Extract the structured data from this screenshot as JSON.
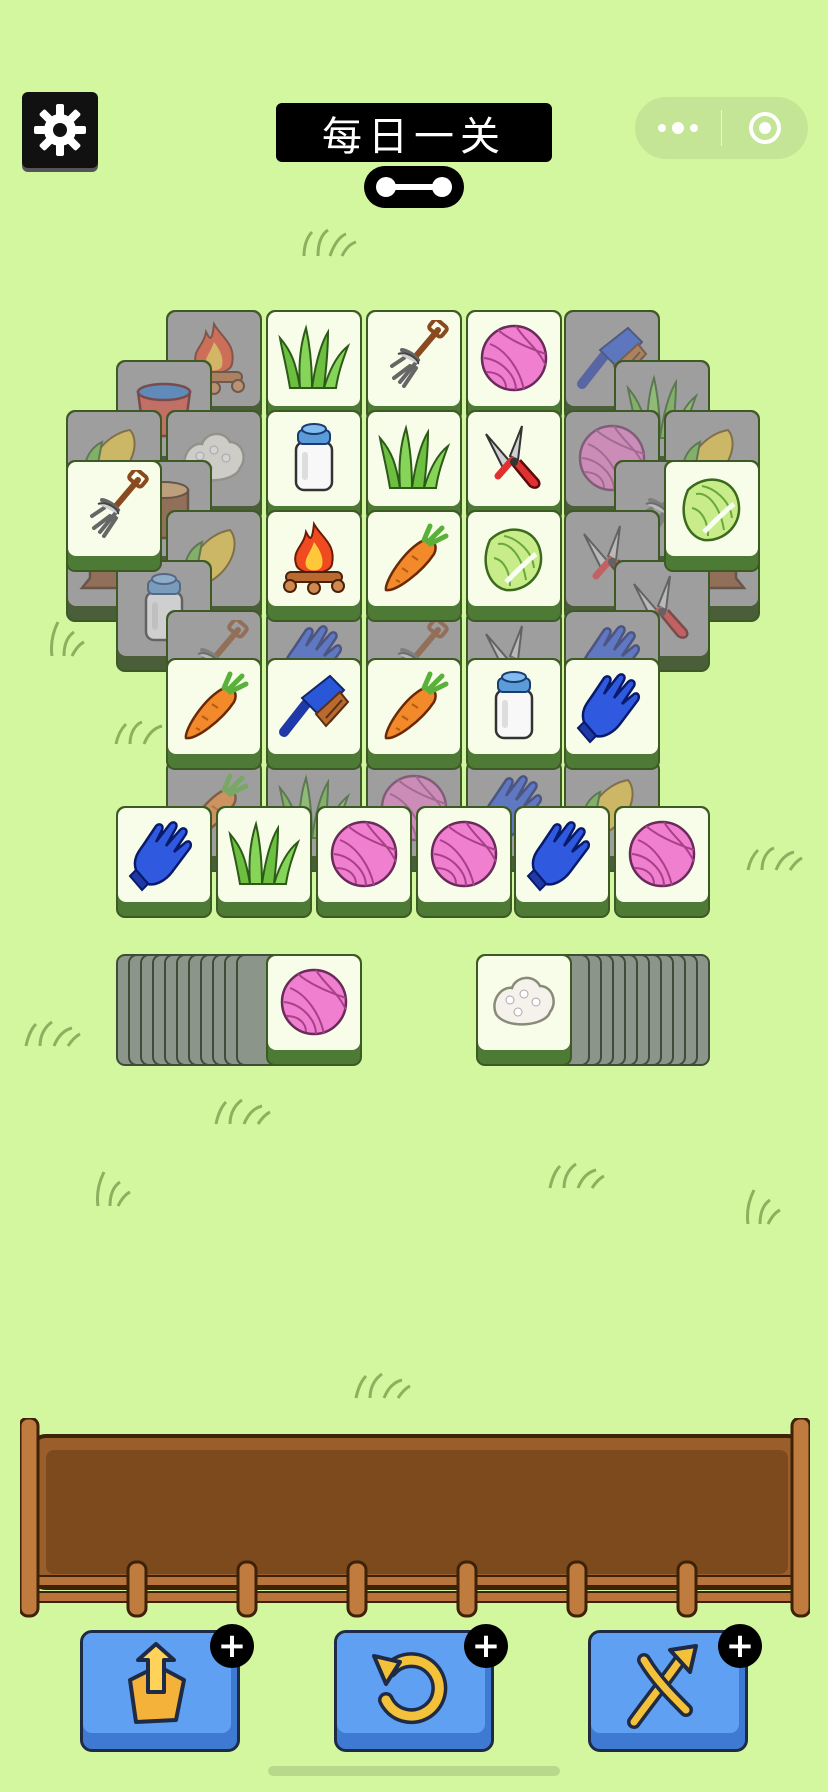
{
  "header": {
    "title": "每日一关",
    "settings_icon": "gear-icon",
    "menu_icon": "more-dots-icon",
    "close_icon": "target-circle-icon"
  },
  "progress": {
    "icon": "bone-progress-icon"
  },
  "board": {
    "top_layer_tiles": [
      "grass",
      "pitchfork",
      "yarn",
      "brush",
      "milk",
      "grass",
      "shears",
      "campfire",
      "carrot",
      "cabbage",
      "pitchfork",
      "cabbage",
      "carrot",
      "brush",
      "carrot",
      "milk",
      "glove",
      "glove",
      "grass",
      "yarn",
      "yarn",
      "glove",
      "yarn"
    ],
    "left_stack_top": "yarn",
    "right_stack_top": "rice",
    "left_stack_count": 12,
    "right_stack_count": 12
  },
  "tray": {
    "slots": 7,
    "filled": 0
  },
  "tools": [
    {
      "name": "move-out",
      "icon": "pop-out-icon"
    },
    {
      "name": "undo",
      "icon": "undo-icon"
    },
    {
      "name": "shuffle",
      "icon": "shuffle-icon"
    }
  ],
  "colors": {
    "background": "#d3f79e",
    "tile_face": "#f7fde8",
    "tile_side": "#4d7a34",
    "button_blue": "#5fa0f2",
    "tray_wood": "#8b5a2b"
  }
}
